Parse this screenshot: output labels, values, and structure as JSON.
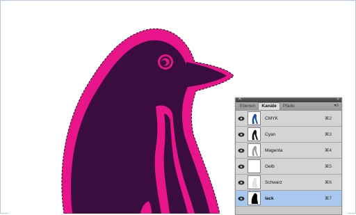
{
  "panel": {
    "tabs": [
      "Ebenen",
      "Kanäle",
      "Pfade"
    ],
    "active_tab": "Kanäle",
    "channels": [
      {
        "name": "CMYK",
        "shortcut": "⌘2",
        "thumb": "cmyk",
        "selected": false
      },
      {
        "name": "Cyan",
        "shortcut": "⌘3",
        "thumb": "cyan",
        "selected": false
      },
      {
        "name": "Magenta",
        "shortcut": "⌘4",
        "thumb": "magenta",
        "selected": false
      },
      {
        "name": "Gelb",
        "shortcut": "⌘5",
        "thumb": "gelb",
        "selected": false
      },
      {
        "name": "Schwarz",
        "shortcut": "⌘6",
        "thumb": "schwarz",
        "selected": false
      },
      {
        "name": "lack",
        "shortcut": "⌘7",
        "thumb": "lack",
        "selected": true
      }
    ]
  },
  "colors": {
    "penguin_dark": "#3a0c3f",
    "penguin_pink": "#e8158a",
    "selection_row": "#a9c8ef",
    "panel_bg": "#d4d4d4"
  }
}
